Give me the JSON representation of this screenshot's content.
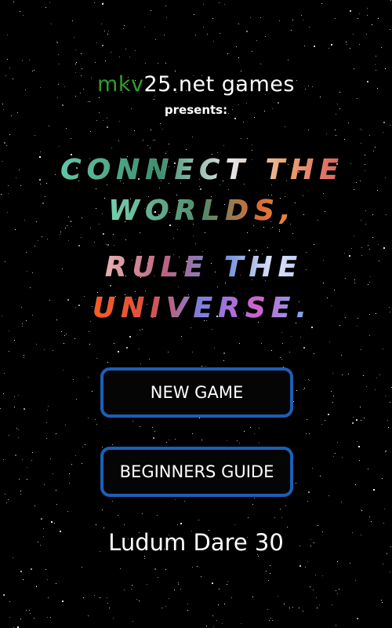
{
  "header": {
    "brand_prefix": "mkv",
    "brand_suffix": "25.net games",
    "presents": "presents:"
  },
  "title": {
    "line1": "CONNECT THE",
    "line2": "WORLDS,",
    "line3": "RULE THE",
    "line4": "UNIVERSE."
  },
  "menu": {
    "new_game": "NEW GAME",
    "guide": "BEGINNERS GUIDE"
  },
  "footer": {
    "event": "Ludum Dare 30"
  },
  "colors": {
    "background": "#000000",
    "button_border": "#1c5fb7",
    "brand_green": "#2f9e2f",
    "text": "#ffffff"
  }
}
